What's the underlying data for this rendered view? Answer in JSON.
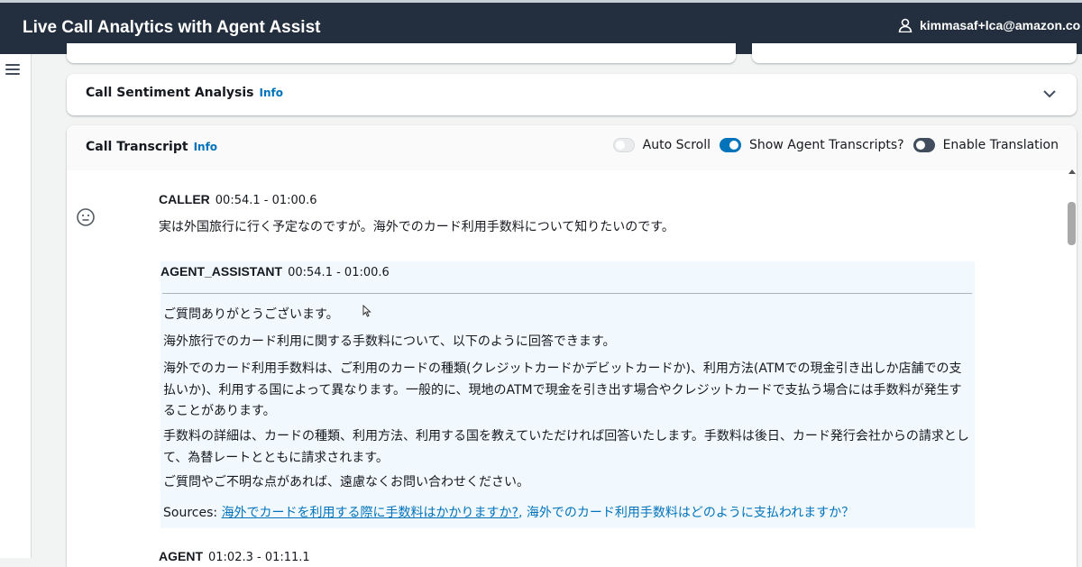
{
  "header": {
    "app_title": "Live Call Analytics with Agent Assist",
    "user": "kimmasaf+lca@amazon.co"
  },
  "sentiment_panel": {
    "title": "Call Sentiment Analysis",
    "info": "Info"
  },
  "transcript_panel": {
    "title": "Call Transcript",
    "info": "Info",
    "toggles": [
      {
        "label": "Auto Scroll",
        "state": "off"
      },
      {
        "label": "Show Agent Transcripts?",
        "state": "on"
      },
      {
        "label": "Enable Translation",
        "state": "off"
      }
    ]
  },
  "entries": [
    {
      "speaker": "CALLER",
      "time": "00:54.1 - 01:00.6",
      "text": "実は外国旅行に行く予定なのですが。海外でのカード利用手数料について知りたいのです。"
    },
    {
      "speaker": "AGENT_ASSISTANT",
      "time": "00:54.1 - 01:00.6",
      "paragraphs": [
        "ご質問ありがとうございます。",
        "海外旅行でのカード利用に関する手数料について、以下のように回答できます。",
        "海外でのカード利用手数料は、ご利用のカードの種類(クレジットカードかデビットカードか)、利用方法(ATMでの現金引き出しか店舗での支払いか)、利用する国によって異なります。一般的に、現地のATMで現金を引き出す場合やクレジットカードで支払う場合には手数料が発生することがあります。",
        "手数料の詳細は、カードの種類、利用方法、利用する国を教えていただければ回答いたします。手数料は後日、カード発行会社からの請求として、為替レートとともに請求されます。",
        "ご質問やご不明な点があれば、遠慮なくお問い合わせください。"
      ],
      "sources_label": "Sources:",
      "sources": [
        "海外でカードを利用する際に手数料はかかりますか?",
        "海外でのカード利用手数料はどのように支払われますか？"
      ]
    },
    {
      "speaker": "AGENT",
      "time": "01:02.3 - 01:11.1"
    }
  ],
  "colors": {
    "topbar": "#232f3e",
    "link": "#0073bb",
    "toggle_on": "#0073bb",
    "assist_bg": "#f1f8fe"
  }
}
